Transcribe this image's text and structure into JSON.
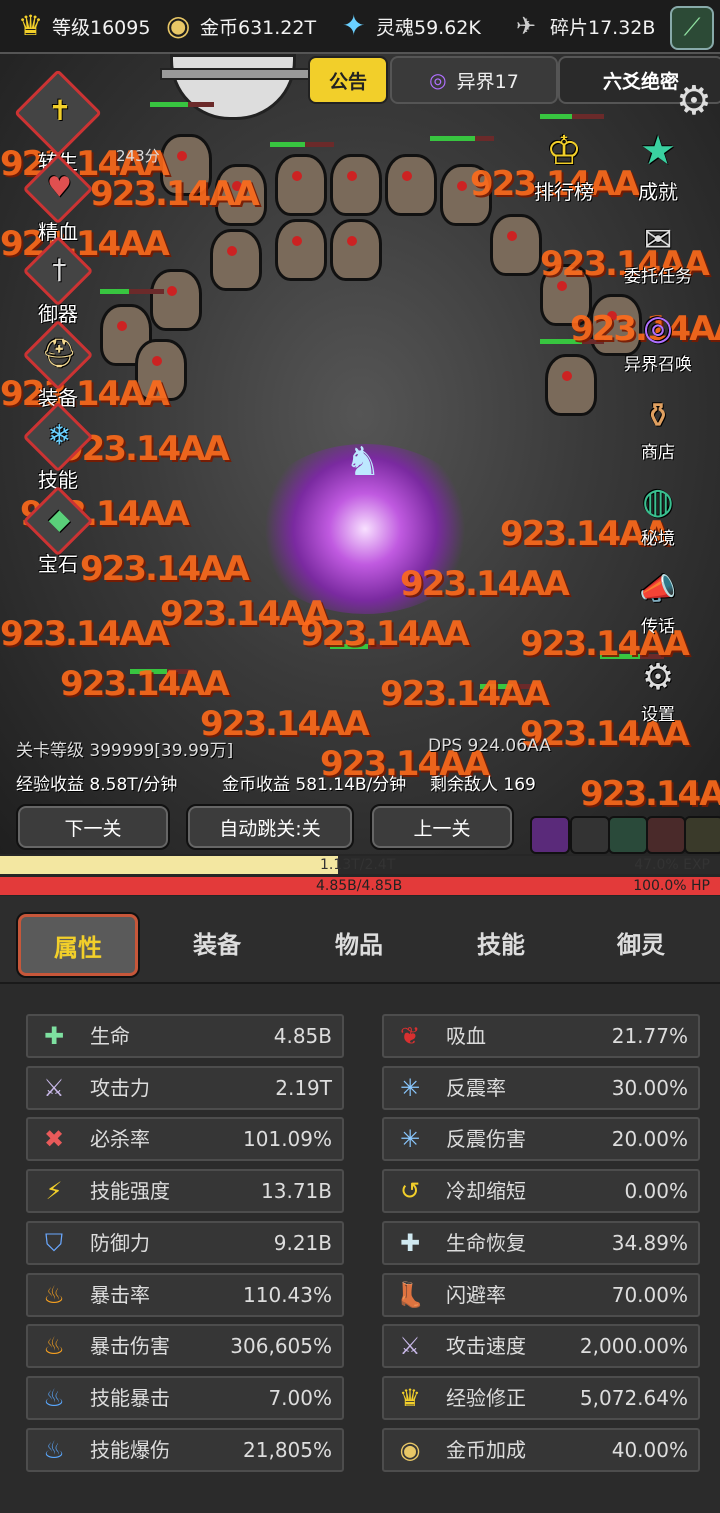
{
  "resources": [
    {
      "icon": "crown-icon",
      "glyph": "♛",
      "color": "#f2cf2a",
      "label": "等级16095"
    },
    {
      "icon": "coin-icon",
      "glyph": "◉",
      "color": "#e8c766",
      "label": "金币631.22T"
    },
    {
      "icon": "soul-icon",
      "glyph": "✦",
      "color": "#6ad0ff",
      "label": "灵魂59.62K"
    },
    {
      "icon": "shard-icon",
      "glyph": "✈",
      "color": "#cccccc",
      "label": "碎片17.32B"
    }
  ],
  "header_tabs": {
    "notice": "公告",
    "realm": "异界17",
    "secret": "六爻绝密"
  },
  "left_menu": [
    {
      "name": "rebirth",
      "label": "转生",
      "glyph": "✝",
      "sub": "243分"
    },
    {
      "name": "essence",
      "label": "精血",
      "glyph": "♥",
      "sub": ""
    },
    {
      "name": "weapon-spirit",
      "label": "御器",
      "glyph": "†",
      "sub": ""
    },
    {
      "name": "equipment",
      "label": "装备",
      "glyph": "⛑",
      "sub": ""
    },
    {
      "name": "skills",
      "label": "技能",
      "glyph": "❄",
      "sub": ""
    },
    {
      "name": "gems",
      "label": "宝石",
      "glyph": "◆",
      "sub": ""
    }
  ],
  "right_menu": [
    {
      "name": "leaderboard",
      "label": "排行榜",
      "glyph": "♔"
    },
    {
      "name": "achievements",
      "label": "成就",
      "glyph": "★"
    },
    {
      "name": "commission-tasks",
      "label": "委托任务",
      "glyph": "✉"
    },
    {
      "name": "realm-summon",
      "label": "异界召唤",
      "glyph": "◎"
    },
    {
      "name": "shop",
      "label": "商店",
      "glyph": "⚱"
    },
    {
      "name": "secret-realm",
      "label": "秘境",
      "glyph": "◍"
    },
    {
      "name": "broadcast",
      "label": "传话",
      "glyph": "📣"
    },
    {
      "name": "settings",
      "label": "设置",
      "glyph": "⚙"
    }
  ],
  "damage_text": "923.14AA",
  "battle": {
    "stage_level": "关卡等级 399999[39.99万]",
    "dps": "DPS 924.06AA",
    "exp_income": "经验收益 8.58T/分钟",
    "gold_income": "金币收益 581.14B/分钟",
    "enemies_left": "剩余敌人 169"
  },
  "nav": {
    "next": "下一关",
    "auto": "自动跳关:关",
    "prev": "上一关"
  },
  "exp_bar": {
    "text": "1.13T/2.4T",
    "percent_text": "47.0% EXP",
    "fill": 0.47
  },
  "hp_bar": {
    "text": "4.85B/4.85B",
    "percent_text": "100.0%  HP",
    "fill": 1.0
  },
  "tabs": [
    "属性",
    "装备",
    "物品",
    "技能",
    "御灵"
  ],
  "stats_left": [
    {
      "icon": "life-icon",
      "glyph": "✚",
      "color": "#7ee0a0",
      "label": "生命",
      "value": "4.85B"
    },
    {
      "icon": "sword-icon",
      "glyph": "⚔",
      "color": "#c8b8e8",
      "label": "攻击力",
      "value": "2.19T"
    },
    {
      "icon": "kill-icon",
      "glyph": "✖",
      "color": "#e85a5a",
      "label": "必杀率",
      "value": "101.09%"
    },
    {
      "icon": "lightning-icon",
      "glyph": "⚡",
      "color": "#f2cf2a",
      "label": "技能强度",
      "value": "13.71B"
    },
    {
      "icon": "shield-icon",
      "glyph": "⛉",
      "color": "#6aa8ff",
      "label": "防御力",
      "value": "9.21B"
    },
    {
      "icon": "flame-icon",
      "glyph": "♨",
      "color": "#f6a020",
      "label": "暴击率",
      "value": "110.43%"
    },
    {
      "icon": "flame-icon",
      "glyph": "♨",
      "color": "#f6a020",
      "label": "暴击伤害",
      "value": "306,605%"
    },
    {
      "icon": "blue-flame-icon",
      "glyph": "♨",
      "color": "#5aa8ff",
      "label": "技能暴击",
      "value": "7.00%"
    },
    {
      "icon": "blue-flame-icon",
      "glyph": "♨",
      "color": "#5aa8ff",
      "label": "技能爆伤",
      "value": "21,805%"
    }
  ],
  "stats_right": [
    {
      "icon": "lips-icon",
      "glyph": "❦",
      "color": "#d83030",
      "label": "吸血",
      "value": "21.77%"
    },
    {
      "icon": "ice-burst-icon",
      "glyph": "✳",
      "color": "#8ac8ff",
      "label": "反震率",
      "value": "30.00%"
    },
    {
      "icon": "ice-burst-icon",
      "glyph": "✳",
      "color": "#8ac8ff",
      "label": "反震伤害",
      "value": "20.00%"
    },
    {
      "icon": "cooldown-icon",
      "glyph": "↺",
      "color": "#f2cf2a",
      "label": "冷却缩短",
      "value": "0.00%"
    },
    {
      "icon": "regen-icon",
      "glyph": "✚",
      "color": "#cfe8f0",
      "label": "生命恢复",
      "value": "34.89%"
    },
    {
      "icon": "boot-icon",
      "glyph": "👢",
      "color": "#f2d890",
      "label": "闪避率",
      "value": "70.00%"
    },
    {
      "icon": "swords-icon",
      "glyph": "⚔",
      "color": "#c8b8e8",
      "label": "攻击速度",
      "value": "2,000.00%"
    },
    {
      "icon": "crown-icon",
      "glyph": "♛",
      "color": "#f2cf2a",
      "label": "经验修正",
      "value": "5,072.64%"
    },
    {
      "icon": "coin-icon",
      "glyph": "◉",
      "color": "#e8c766",
      "label": "金币加成",
      "value": "40.00%"
    }
  ]
}
